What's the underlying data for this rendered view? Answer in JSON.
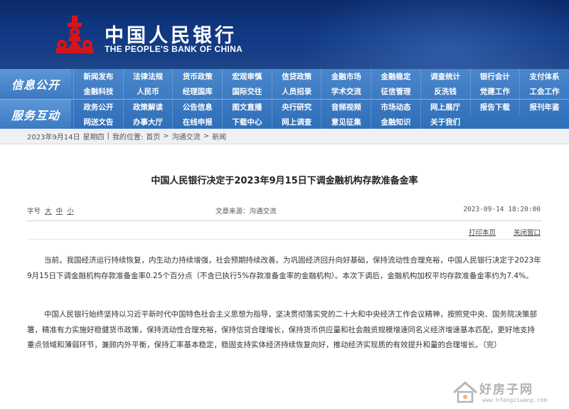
{
  "header": {
    "bank_name_cn": "中国人民银行",
    "bank_name_en": "THE PEOPLE'S BANK OF CHINA",
    "logo_icon": "pboc-logo-icon",
    "brand_red": "#d7141a"
  },
  "nav": {
    "section1_title": "信息公开",
    "section2_title": "服务互动",
    "row1": [
      "新闻发布",
      "法律法规",
      "货币政策",
      "宏观审慎",
      "信贷政策",
      "金融市场",
      "金融稳定",
      "调查统计",
      "银行会计",
      "支付体系"
    ],
    "row2": [
      "金融科技",
      "人民币",
      "经理国库",
      "国际交往",
      "人员招录",
      "学术交流",
      "征信管理",
      "反洗钱",
      "党建工作",
      "工会工作"
    ],
    "row3": [
      "政务公开",
      "政策解读",
      "公告信息",
      "图文直播",
      "央行研究",
      "音频视频",
      "市场动态",
      "网上展厅",
      "报告下载",
      "报刊年鉴"
    ],
    "row4": [
      "网送文告",
      "办事大厅",
      "在线申报",
      "下载中心",
      "网上调查",
      "意见征集",
      "金融知识",
      "关于我们"
    ]
  },
  "breadcrumb": {
    "date": "2023年9月14日",
    "weekday": "星期四",
    "sep": "|",
    "location_label": "我的位置:",
    "home": "首页",
    "arrow1": ">",
    "section": "沟通交流",
    "arrow2": ">",
    "current": "新闻"
  },
  "article": {
    "title": "中国人民银行决定于2023年9月15日下调金融机构存款准备金率",
    "font_size_label": "字号",
    "font_big": "大",
    "font_mid": "中",
    "font_small": "小",
    "source": "文章来源：沟通交流",
    "datetime": "2023-09-14 18:20:00",
    "print_label": "打印本页",
    "close_label": "关闭窗口",
    "paragraph1": "当前，我国经济运行持续恢复，内生动力持续增强，社会预期持续改善。为巩固经济回升向好基础，保持流动性合理充裕，中国人民银行决定于2023年9月15日下调金融机构存款准备金率0.25个百分点（不含已执行5%存款准备金率的金融机构）。本次下调后，金融机构加权平均存款准备金率约为7.4%。",
    "paragraph2": "中国人民银行始终坚持以习近平新时代中国特色社会主义思想为指导，坚决贯彻落实党的二十大和中央经济工作会议精神，按照党中央、国务院决策部署，精准有力实施好稳健货币政策，保持流动性合理充裕，保持信贷合理增长，保持货币供应量和社会融资规模增速同名义经济增速基本匹配，更好地支持重点领域和薄弱环节，兼顾内外平衡，保持汇率基本稳定，稳固支持实体经济持续恢复向好，推动经济实现质的有效提升和量的合理增长。（完）"
  },
  "watermark": {
    "text": "好房子网",
    "url": "www.hfangziwang.com"
  }
}
